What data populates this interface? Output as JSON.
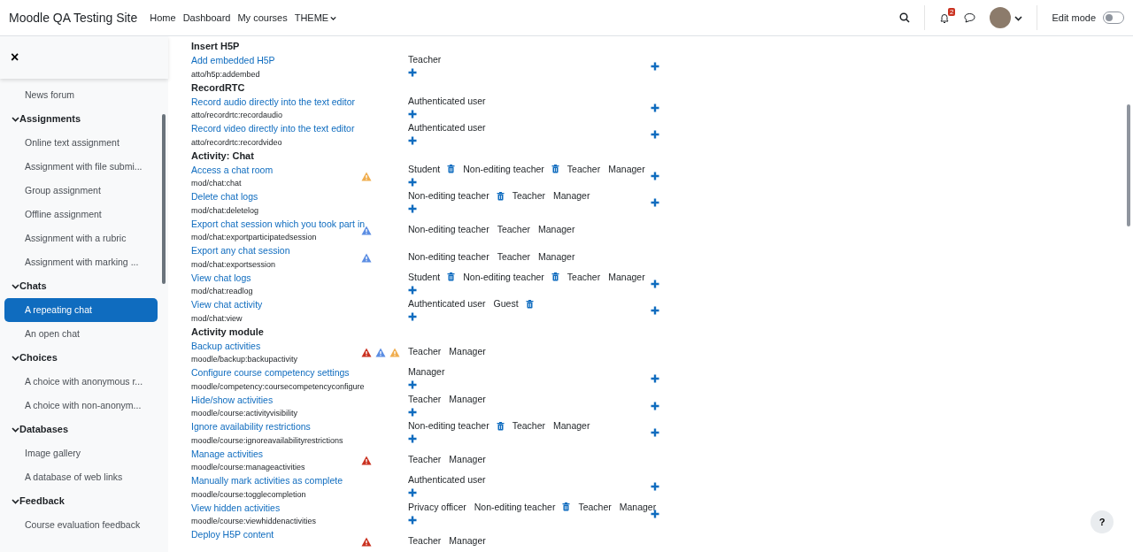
{
  "navbar": {
    "site_name": "Moodle QA Testing Site",
    "links": [
      {
        "label": "Home",
        "dropdown": false
      },
      {
        "label": "Dashboard",
        "dropdown": false
      },
      {
        "label": "My courses",
        "dropdown": false
      },
      {
        "label": "THEME",
        "dropdown": true
      }
    ],
    "notification_count": "2",
    "edit_mode": {
      "label": "Edit mode",
      "on": false
    }
  },
  "sidebar": {
    "close": "×",
    "sections": [
      {
        "items": [
          {
            "label": "News forum",
            "selected": false
          }
        ]
      },
      {
        "title": "Assignments",
        "expanded": true,
        "items": [
          {
            "label": "Online text assignment",
            "selected": false
          },
          {
            "label": "Assignment with file submi...",
            "selected": false
          },
          {
            "label": "Group assignment",
            "selected": false
          },
          {
            "label": "Offline assignment",
            "selected": false
          },
          {
            "label": "Assignment with a rubric",
            "selected": false
          },
          {
            "label": "Assignment with marking ...",
            "selected": false
          }
        ]
      },
      {
        "title": "Chats",
        "expanded": true,
        "items": [
          {
            "label": "A repeating chat",
            "selected": true
          },
          {
            "label": "An open chat",
            "selected": false
          }
        ]
      },
      {
        "title": "Choices",
        "expanded": true,
        "items": [
          {
            "label": "A choice with anonymous r...",
            "selected": false
          },
          {
            "label": "A choice with non-anonym...",
            "selected": false
          }
        ]
      },
      {
        "title": "Databases",
        "expanded": true,
        "items": [
          {
            "label": "Image gallery",
            "selected": false
          },
          {
            "label": "A database of web links",
            "selected": false
          }
        ]
      },
      {
        "title": "Feedback",
        "expanded": true,
        "items": [
          {
            "label": "Course evaluation feedback",
            "selected": false
          }
        ]
      }
    ]
  },
  "groups": [
    {
      "heading": "Insert H5P",
      "capabilities": [
        {
          "name": "Add embedded H5P",
          "path": "atto/h5p:addembed",
          "roles": [
            {
              "name": "Teacher",
              "removable": false
            }
          ],
          "can_add": true,
          "can_prohibit": true
        }
      ]
    },
    {
      "heading": "RecordRTC",
      "capabilities": [
        {
          "name": "Record audio directly into the text editor",
          "path": "atto/recordrtc:recordaudio",
          "roles": [
            {
              "name": "Authenticated user",
              "removable": false
            }
          ],
          "can_add": true,
          "can_prohibit": true
        },
        {
          "name": "Record video directly into the text editor",
          "path": "atto/recordrtc:recordvideo",
          "roles": [
            {
              "name": "Authenticated user",
              "removable": false
            }
          ],
          "can_add": true,
          "can_prohibit": true
        }
      ]
    },
    {
      "heading": "Activity: Chat",
      "capabilities": [
        {
          "name": "Access a chat room",
          "path": "mod/chat:chat",
          "risks": [
            {
              "kind": "spam"
            }
          ],
          "roles": [
            {
              "name": "Student",
              "removable": true
            },
            {
              "name": "Non-editing teacher",
              "removable": true
            },
            {
              "name": "Teacher",
              "removable": false
            },
            {
              "name": "Manager",
              "removable": false
            }
          ],
          "can_add": true,
          "can_prohibit": true
        },
        {
          "name": "Delete chat logs",
          "path": "mod/chat:deletelog",
          "roles": [
            {
              "name": "Non-editing teacher",
              "removable": true
            },
            {
              "name": "Teacher",
              "removable": false
            },
            {
              "name": "Manager",
              "removable": false
            }
          ],
          "can_add": true,
          "can_prohibit": true
        },
        {
          "name": "Export chat session which you took part in",
          "path": "mod/chat:exportparticipatedsession",
          "risks": [
            {
              "kind": "personal"
            }
          ],
          "roles": [
            {
              "name": "Non-editing teacher",
              "removable": false
            },
            {
              "name": "Teacher",
              "removable": false
            },
            {
              "name": "Manager",
              "removable": false
            }
          ],
          "can_add": false,
          "can_prohibit": false
        },
        {
          "name": "Export any chat session",
          "path": "mod/chat:exportsession",
          "risks": [
            {
              "kind": "personal"
            }
          ],
          "roles": [
            {
              "name": "Non-editing teacher",
              "removable": false
            },
            {
              "name": "Teacher",
              "removable": false
            },
            {
              "name": "Manager",
              "removable": false
            }
          ],
          "can_add": false,
          "can_prohibit": false
        },
        {
          "name": "View chat logs",
          "path": "mod/chat:readlog",
          "roles": [
            {
              "name": "Student",
              "removable": true
            },
            {
              "name": "Non-editing teacher",
              "removable": true
            },
            {
              "name": "Teacher",
              "removable": false
            },
            {
              "name": "Manager",
              "removable": false
            }
          ],
          "can_add": true,
          "can_prohibit": true
        },
        {
          "name": "View chat activity",
          "path": "mod/chat:view",
          "roles": [
            {
              "name": "Authenticated user",
              "removable": false
            },
            {
              "name": "Guest",
              "removable": true
            }
          ],
          "can_add": true,
          "can_prohibit": true
        }
      ]
    },
    {
      "heading": "Activity module",
      "capabilities": [
        {
          "name": "Backup activities",
          "path": "moodle/backup:backupactivity",
          "risks": [
            {
              "kind": "config"
            },
            {
              "kind": "personal"
            },
            {
              "kind": "spam"
            }
          ],
          "roles": [
            {
              "name": "Teacher",
              "removable": false
            },
            {
              "name": "Manager",
              "removable": false
            }
          ],
          "can_add": false,
          "can_prohibit": false
        },
        {
          "name": "Configure course competency settings",
          "path": "moodle/competency:coursecompetencyconfigure",
          "roles": [
            {
              "name": "Manager",
              "removable": false
            }
          ],
          "can_add": true,
          "can_prohibit": true
        },
        {
          "name": "Hide/show activities",
          "path": "moodle/course:activityvisibility",
          "roles": [
            {
              "name": "Teacher",
              "removable": false
            },
            {
              "name": "Manager",
              "removable": false
            }
          ],
          "can_add": true,
          "can_prohibit": true
        },
        {
          "name": "Ignore availability restrictions",
          "path": "moodle/course:ignoreavailabilityrestrictions",
          "roles": [
            {
              "name": "Non-editing teacher",
              "removable": true
            },
            {
              "name": "Teacher",
              "removable": false
            },
            {
              "name": "Manager",
              "removable": false
            }
          ],
          "can_add": true,
          "can_prohibit": true
        },
        {
          "name": "Manage activities",
          "path": "moodle/course:manageactivities",
          "risks": [
            {
              "kind": "config"
            }
          ],
          "roles": [
            {
              "name": "Teacher",
              "removable": false
            },
            {
              "name": "Manager",
              "removable": false
            }
          ],
          "can_add": false,
          "can_prohibit": false
        },
        {
          "name": "Manually mark activities as complete",
          "path": "moodle/course:togglecompletion",
          "roles": [
            {
              "name": "Authenticated user",
              "removable": false
            }
          ],
          "can_add": true,
          "can_prohibit": true
        },
        {
          "name": "View hidden activities",
          "path": "moodle/course:viewhiddenactivities",
          "roles": [
            {
              "name": "Privacy officer",
              "removable": false
            },
            {
              "name": "Non-editing teacher",
              "removable": true
            },
            {
              "name": "Teacher",
              "removable": false
            },
            {
              "name": "Manager",
              "removable": false
            }
          ],
          "can_add": true,
          "can_prohibit": true
        },
        {
          "name": "Deploy H5P content",
          "risks": [
            {
              "kind": "config"
            }
          ],
          "roles": [
            {
              "name": "Teacher",
              "removable": false
            },
            {
              "name": "Manager",
              "removable": false
            }
          ],
          "can_add": false,
          "can_prohibit": false
        }
      ]
    }
  ],
  "help_button": "?"
}
